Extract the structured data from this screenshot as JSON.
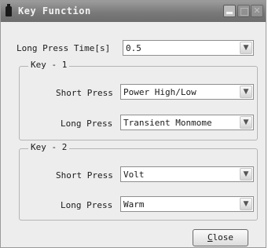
{
  "window": {
    "title": "Key Function",
    "icon": "app-icon"
  },
  "long_press_time": {
    "label": "Long Press Time[s]",
    "value": "0.5"
  },
  "key1": {
    "legend": "Key - 1",
    "short_press": {
      "label": "Short Press",
      "value": "Power High/Low"
    },
    "long_press": {
      "label": "Long Press",
      "value": "Transient Monmome"
    }
  },
  "key2": {
    "legend": "Key - 2",
    "short_press": {
      "label": "Short Press",
      "value": "Volt"
    },
    "long_press": {
      "label": "Long Press",
      "value": "Warm"
    }
  },
  "close_button": {
    "mnemonic": "C",
    "rest": "lose"
  },
  "icons": {
    "dropdown_arrow": "chevron-down-icon",
    "close": "close-icon"
  },
  "colors": {
    "titlebar": "#7a7a7a",
    "dialog_bg": "#ededed"
  }
}
